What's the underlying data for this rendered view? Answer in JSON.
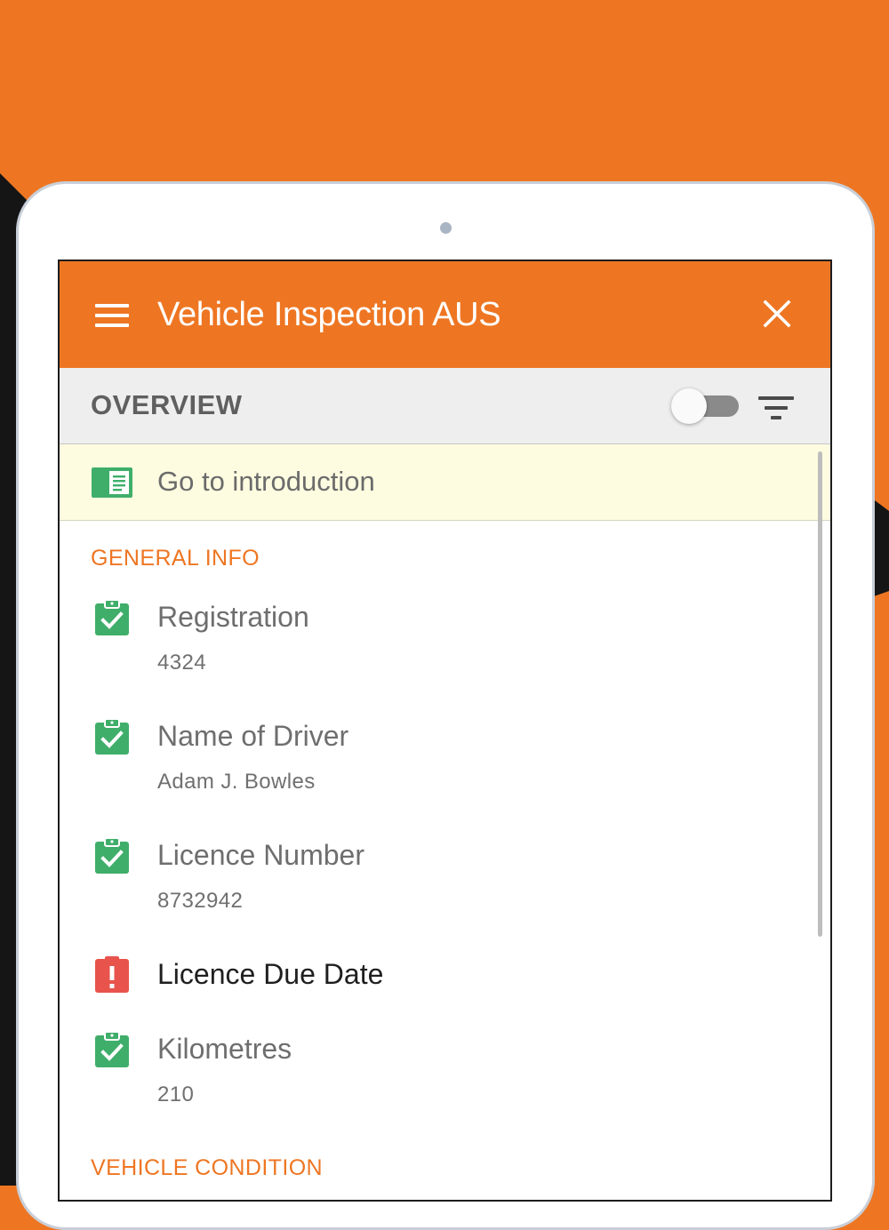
{
  "app": {
    "title": "Vehicle Inspection AUS",
    "accent_color": "#ee7623"
  },
  "header": {
    "menu_icon": "hamburger-menu-icon",
    "close_icon": "close-icon"
  },
  "overview": {
    "title": "OVERVIEW",
    "toggle_on": false,
    "filter_icon": "filter-icon"
  },
  "intro": {
    "label": "Go to introduction",
    "icon": "book-icon",
    "icon_color": "#3fae6a"
  },
  "sections": [
    {
      "title": "GENERAL INFO",
      "items": [
        {
          "label": "Registration",
          "value": "4324",
          "status": "complete"
        },
        {
          "label": "Name of Driver",
          "value": "Adam J. Bowles",
          "status": "complete"
        },
        {
          "label": "Licence Number",
          "value": "8732942",
          "status": "complete"
        },
        {
          "label": "Licence Due Date",
          "value": "",
          "status": "error"
        },
        {
          "label": "Kilometres",
          "value": "210",
          "status": "complete"
        }
      ]
    },
    {
      "title": "VEHICLE CONDITION",
      "items": []
    }
  ],
  "status_colors": {
    "complete": "#3fae6a",
    "error": "#e8534c"
  }
}
